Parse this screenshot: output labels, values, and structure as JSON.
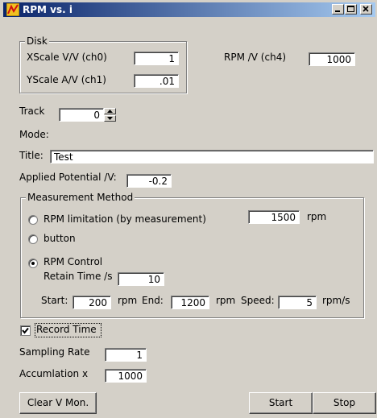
{
  "window": {
    "title": "RPM vs. i",
    "accent": "#0a246a",
    "background": "#d4d0c8"
  },
  "titlebar_buttons": [
    "minimize-icon",
    "maximize-icon",
    "close-icon"
  ],
  "disk": {
    "legend": "Disk",
    "xscale_label": "XScale V/V (ch0)",
    "xscale_value": "1",
    "yscale_label": "YScale A/V (ch1)",
    "yscale_value": ".01"
  },
  "rpm": {
    "label": "RPM /V (ch4)",
    "value": "1000"
  },
  "track": {
    "label": "Track",
    "value": "0"
  },
  "mode": {
    "label": "Mode:"
  },
  "title_field": {
    "label": "Title:",
    "value": "Test"
  },
  "applied_potential": {
    "label": "Applied Potential /V:",
    "value": "-0.2"
  },
  "measurement": {
    "legend": "Measurement Method",
    "options": [
      {
        "label": "RPM limitation (by measurement)",
        "checked": false
      },
      {
        "label": "button",
        "checked": false
      },
      {
        "label": "RPM Control",
        "checked": true
      }
    ],
    "rpm_limit_value": "1500",
    "rpm_unit": "rpm",
    "retain_label": "Retain Time /s",
    "retain_value": "10",
    "start_label": "Start:",
    "start_value": "200",
    "start_unit": "rpm",
    "end_label": "End:",
    "end_value": "1200",
    "end_unit": "rpm",
    "speed_label": "Speed:",
    "speed_value": "5",
    "speed_unit": "rpm/s"
  },
  "record_time": {
    "label": "Record Time",
    "checked": true
  },
  "sampling": {
    "label": "Sampling Rate",
    "value": "1"
  },
  "accumulation": {
    "label": "Accumlation  x",
    "value": "1000"
  },
  "buttons": {
    "clear": "Clear V Mon.",
    "start": "Start",
    "stop": "Stop"
  }
}
